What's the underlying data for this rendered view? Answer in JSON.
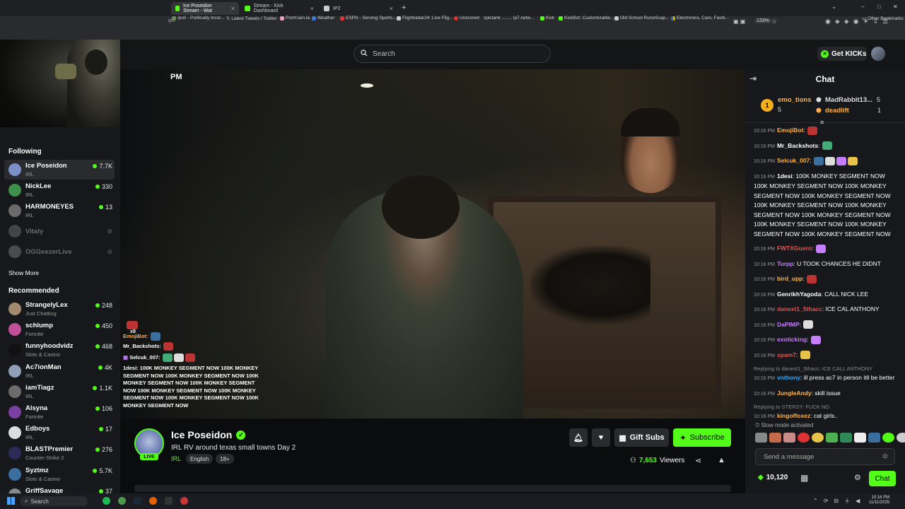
{
  "browser": {
    "tabs": [
      {
        "label": "Ice Poseidon Stream - Wat",
        "active": true
      },
      {
        "label": "Stream - Kick Dashboard",
        "active": false
      },
      {
        "label": "IP2",
        "active": false
      }
    ],
    "new_tab": "+",
    "address": "ipn",
    "zoom": "133%",
    "bookmarks": [
      "/pol/ - Politically Incor...",
      "Latest Tweets / Twitter",
      "Pomf.lain.la",
      "Weather",
      "ESPN - Serving Sports...",
      "Flightradar24: Live Flig...",
      "Unscored",
      "spictank ........ ip7.netw...",
      "Kick",
      "KickBot: Customizable...",
      "Old School RuneScap...",
      "Electronics, Cars, Fashi...",
      "Other Bookmarks"
    ]
  },
  "header": {
    "search_placeholder": "Search",
    "get_kicks": "Get KICKs"
  },
  "sidebar": {
    "following_title": "Following",
    "following": [
      {
        "name": "Ice Poseidon",
        "category": "IRL",
        "viewers": "7.7K",
        "live": true,
        "color": "#7b8fc8"
      },
      {
        "name": "NickLee",
        "category": "IRL",
        "viewers": "330",
        "live": true,
        "color": "#3e8f4b"
      },
      {
        "name": "HARMONEYES",
        "category": "IRL",
        "viewers": "13",
        "live": true,
        "color": "#6a6a6a"
      },
      {
        "name": "Vitaly",
        "category": "",
        "viewers": "",
        "live": false,
        "color": "#888"
      },
      {
        "name": "OGGeezerLive",
        "category": "",
        "viewers": "",
        "live": false,
        "color": "#999"
      }
    ],
    "show_more": "Show More",
    "recommended_title": "Recommended",
    "recommended": [
      {
        "name": "StrangelyLex",
        "category": "Just Chatting",
        "viewers": "248",
        "color": "#a48b6e"
      },
      {
        "name": "schlump",
        "category": "Fortnite",
        "viewers": "450",
        "color": "#c0509a"
      },
      {
        "name": "funnyhoodvidz",
        "category": "Slots & Casino",
        "viewers": "468",
        "color": "#111"
      },
      {
        "name": "Ac7ionMan",
        "category": "IRL",
        "viewers": "4K",
        "color": "#8f9fb8"
      },
      {
        "name": "iamTiagz",
        "category": "IRL",
        "viewers": "1.1K",
        "color": "#6c6c6c"
      },
      {
        "name": "Alsyna",
        "category": "Fortnite",
        "viewers": "106",
        "color": "#7a3fa0"
      },
      {
        "name": "Edboys",
        "category": "IRL",
        "viewers": "17",
        "color": "#ddd"
      },
      {
        "name": "BLASTPremier",
        "category": "Counter-Strike 2",
        "viewers": "276",
        "color": "#2b2b5a"
      },
      {
        "name": "Syztmz",
        "category": "Slots & Casino",
        "viewers": "5.7K",
        "color": "#3a6fa0"
      },
      {
        "name": "GriffSavage",
        "category": "",
        "viewers": "37",
        "color": "#888"
      }
    ]
  },
  "video": {
    "time_text": "PM",
    "overlay_chat": [
      {
        "user": "EmojiBot:",
        "text": ""
      },
      {
        "user": "Mr_Backshots:",
        "text": ""
      },
      {
        "user": "Selcuk_007:",
        "text": ""
      },
      {
        "user": "1desi:",
        "text": "100K MONKEY SEGMENT NOW 100K MONKEY SEGMENT NOW 100K MONKEY SEGMENT NOW 100K MONKEY SEGMENT NOW 100K MONKEY SEGMENT NOW 100K MONKEY SEGMENT NOW 100K MONKEY SEGMENT NOW 100K MONKEY SEGMENT NOW 100K MONKEY SEGMENT NOW"
      }
    ],
    "overlay_x9": "x9"
  },
  "stream": {
    "streamer": "Ice Poseidon",
    "title": "IRL RV around texas small towns Day 2",
    "category": "IRL",
    "tags": [
      "English",
      "18+"
    ],
    "live_label": "LIVE",
    "gift_subs": "Gift Subs",
    "subscribe": "Subscribe",
    "viewers": "7,653",
    "viewers_label": "Viewers"
  },
  "chat": {
    "title": "Chat",
    "top_gifters": [
      {
        "name": "emo_tions",
        "count": "5",
        "rank": "1"
      },
      {
        "name": "MadRabbit13...",
        "count": "5"
      },
      {
        "name": "deadlift",
        "count": "1"
      }
    ],
    "messages": [
      {
        "time": "10:16 PM",
        "user": "EmojiBot",
        "color": "#ffb347",
        "text": "",
        "reply": "",
        "emotes": 1
      },
      {
        "time": "10:16 PM",
        "user": "Mr_Backshots",
        "color": "#ffffff",
        "text": "",
        "reply": "",
        "emotes": 1
      },
      {
        "time": "10:16 PM",
        "user": "Selcuk_007",
        "color": "#ffb347",
        "text": "",
        "reply": "",
        "emotes": 4
      },
      {
        "time": "10:16 PM",
        "user": "1desi",
        "color": "#ffffff",
        "text": "100K MONKEY SEGMENT NOW 100K MONKEY SEGMENT NOW 100K MONKEY SEGMENT NOW 100K MONKEY SEGMENT NOW 100K MONKEY SEGMENT NOW 100K MONKEY SEGMENT NOW 100K MONKEY SEGMENT NOW 100K MONKEY SEGMENT NOW 100K MONKEY SEGMENT NOW 100K MONKEY SEGMENT NOW",
        "reply": "",
        "emotes": 0
      },
      {
        "time": "10:16 PM",
        "user": "FWTXGuero",
        "color": "#e25555",
        "text": "",
        "reply": "",
        "emotes": 1
      },
      {
        "time": "10:16 PM",
        "user": "Turpp",
        "color": "#c77dff",
        "text": "U TOOK CHANCES HE DIDNT",
        "reply": "",
        "emotes": 0
      },
      {
        "time": "10:16 PM",
        "user": "bird_upp",
        "color": "#ffb347",
        "text": "",
        "reply": "",
        "emotes": 1
      },
      {
        "time": "10:16 PM",
        "user": "GenrikhYagoda",
        "color": "#ffffff",
        "text": "CALL NICK LEE",
        "reply": "",
        "emotes": 0
      },
      {
        "time": "10:16 PM",
        "user": "danext1_5thacc",
        "color": "#e25555",
        "text": "ICE CAL ANTHONY",
        "reply": "",
        "emotes": 0
      },
      {
        "time": "10:16 PM",
        "user": "DaPIMP",
        "color": "#c77dff",
        "text": "",
        "reply": "",
        "emotes": 1
      },
      {
        "time": "10:16 PM",
        "user": "exoticking",
        "color": "#c77dff",
        "text": "",
        "reply": "",
        "emotes": 1
      },
      {
        "time": "10:16 PM",
        "user": "spam7",
        "color": "#e25555",
        "text": "",
        "reply": "",
        "emotes": 1
      },
      {
        "time": "10:16 PM",
        "user": "vnthony",
        "color": "#2fa8ff",
        "text": "ill press ac7 in person itll be better",
        "reply": "Replying to danext1_5thacc: ICE CALL ANTHONY",
        "emotes": 0
      },
      {
        "time": "10:16 PM",
        "user": "JungleAndy",
        "color": "#ffb347",
        "text": "skill issue",
        "reply": "",
        "emotes": 0
      },
      {
        "time": "10:16 PM",
        "user": "kingoffoxez",
        "color": "#ffb347",
        "text": "cat girls..",
        "reply": "Replying to STERSY: FUCK NO",
        "emotes": 0
      }
    ],
    "slow_mode": "Slow mode activated",
    "send_placeholder": "Send a message",
    "kick_points": "10,120",
    "send_button": "Chat"
  },
  "taskbar": {
    "search": "Search",
    "clock_time": "10:16 PM",
    "clock_date": "11/11/2025"
  }
}
